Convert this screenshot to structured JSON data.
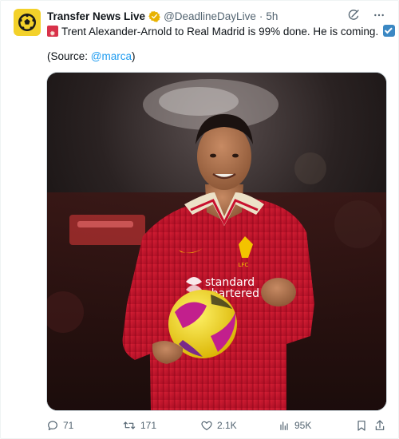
{
  "tweet": {
    "author_name": "Transfer News Live",
    "handle": "@DeadlineDayLive",
    "separator": "·",
    "time": "5h",
    "text": "Trent Alexander-Arnold to Real Madrid is 99% done. He is coming.",
    "source_prefix": "(Source: ",
    "source_link": "@marca",
    "source_suffix": ")"
  },
  "photo": {
    "sponsor_line1": "standard",
    "sponsor_line2": "chartered",
    "crest_text": "LFC"
  },
  "actions": {
    "replies": "71",
    "reposts": "171",
    "likes": "2.1K",
    "views": "95K"
  },
  "colors": {
    "accent": "#1d9bf0",
    "avatar_bg": "#f3d12a",
    "verified_badge": "#e8b200",
    "kit_red": "#c8102e"
  },
  "icons": {
    "avatar": "football-icon",
    "verified": "verified-badge-icon",
    "grok": "grok-icon",
    "more": "more-icon",
    "reply": "reply-icon",
    "repost": "repost-icon",
    "like": "heart-icon",
    "views": "views-icon",
    "bookmark": "bookmark-icon",
    "share": "share-icon"
  }
}
